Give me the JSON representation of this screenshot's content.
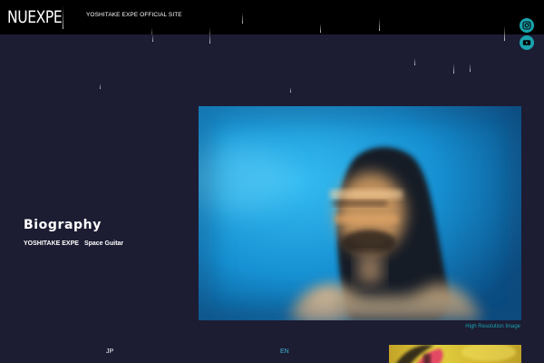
{
  "header": {
    "logo_text": "NUEXPE",
    "site_title": "YOSHITAKE EXPE OFFICIAL SITE"
  },
  "social": [
    {
      "icon": "instagram-icon"
    },
    {
      "icon": "youtube-icon"
    }
  ],
  "biography": {
    "heading": "Biography",
    "name": "YOSHITAKE EXPE",
    "role": "Space Guitar"
  },
  "photo": {
    "download_link": "High Resolution Image"
  },
  "languages": {
    "jp": "JP",
    "en": "EN"
  },
  "colors": {
    "background": "#1c1c33",
    "header": "#000000",
    "accent": "#19a3ad",
    "photo_blue": "#1796d6"
  }
}
